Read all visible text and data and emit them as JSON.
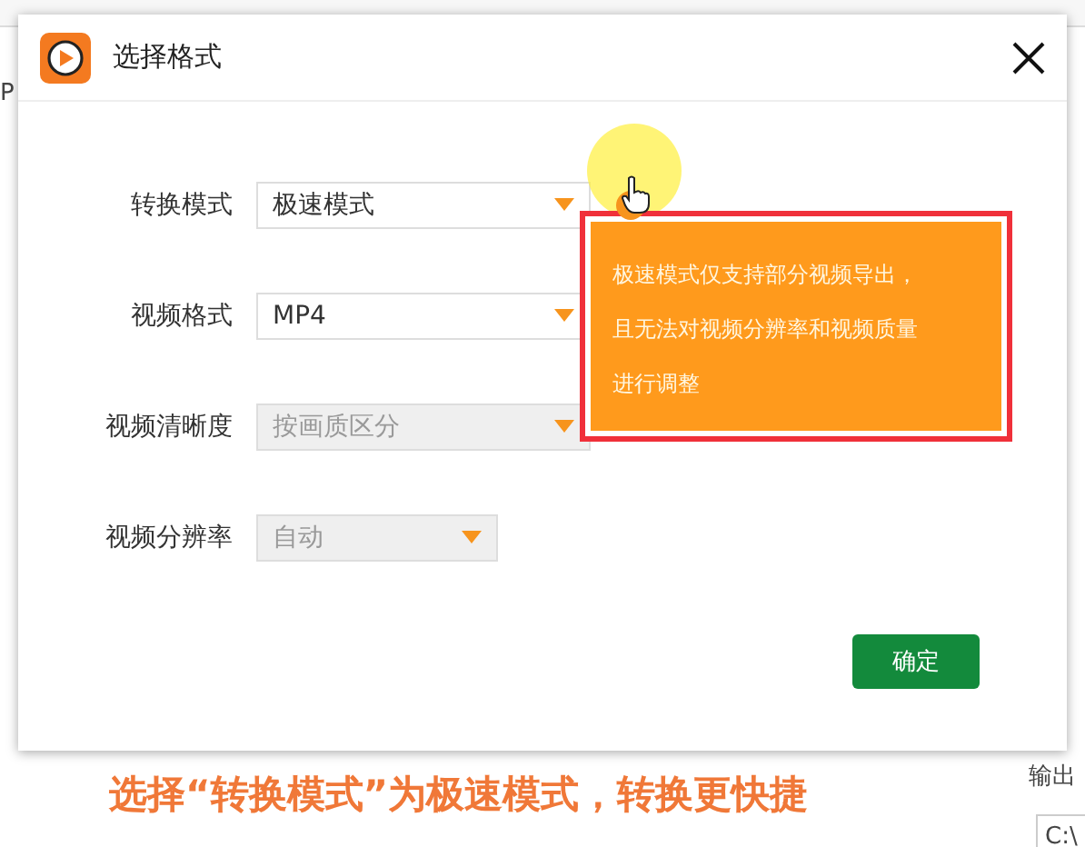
{
  "background_app": {
    "side_text": "P",
    "output_label": "输出",
    "path_text": "C:\\"
  },
  "dialog": {
    "title": "选择格式",
    "fields": [
      {
        "kind": "select_with_help",
        "label": "转换模式",
        "value": "极速模式",
        "disabled": false
      },
      {
        "kind": "select",
        "label": "视频格式",
        "value": "MP4",
        "disabled": false
      },
      {
        "kind": "select",
        "label": "视频清晰度",
        "value": "按画质区分",
        "disabled": true
      },
      {
        "kind": "select",
        "label": "视频分辨率",
        "value": "自动",
        "disabled": true
      }
    ],
    "tooltip": {
      "text": "极速模式仅支持部分视频导出，且无法对视频分辨率和视频质量进行调整",
      "highlighted": true
    },
    "confirm_button": "确定"
  },
  "caption": "选择“转换模式”为极速模式，转换更快捷"
}
